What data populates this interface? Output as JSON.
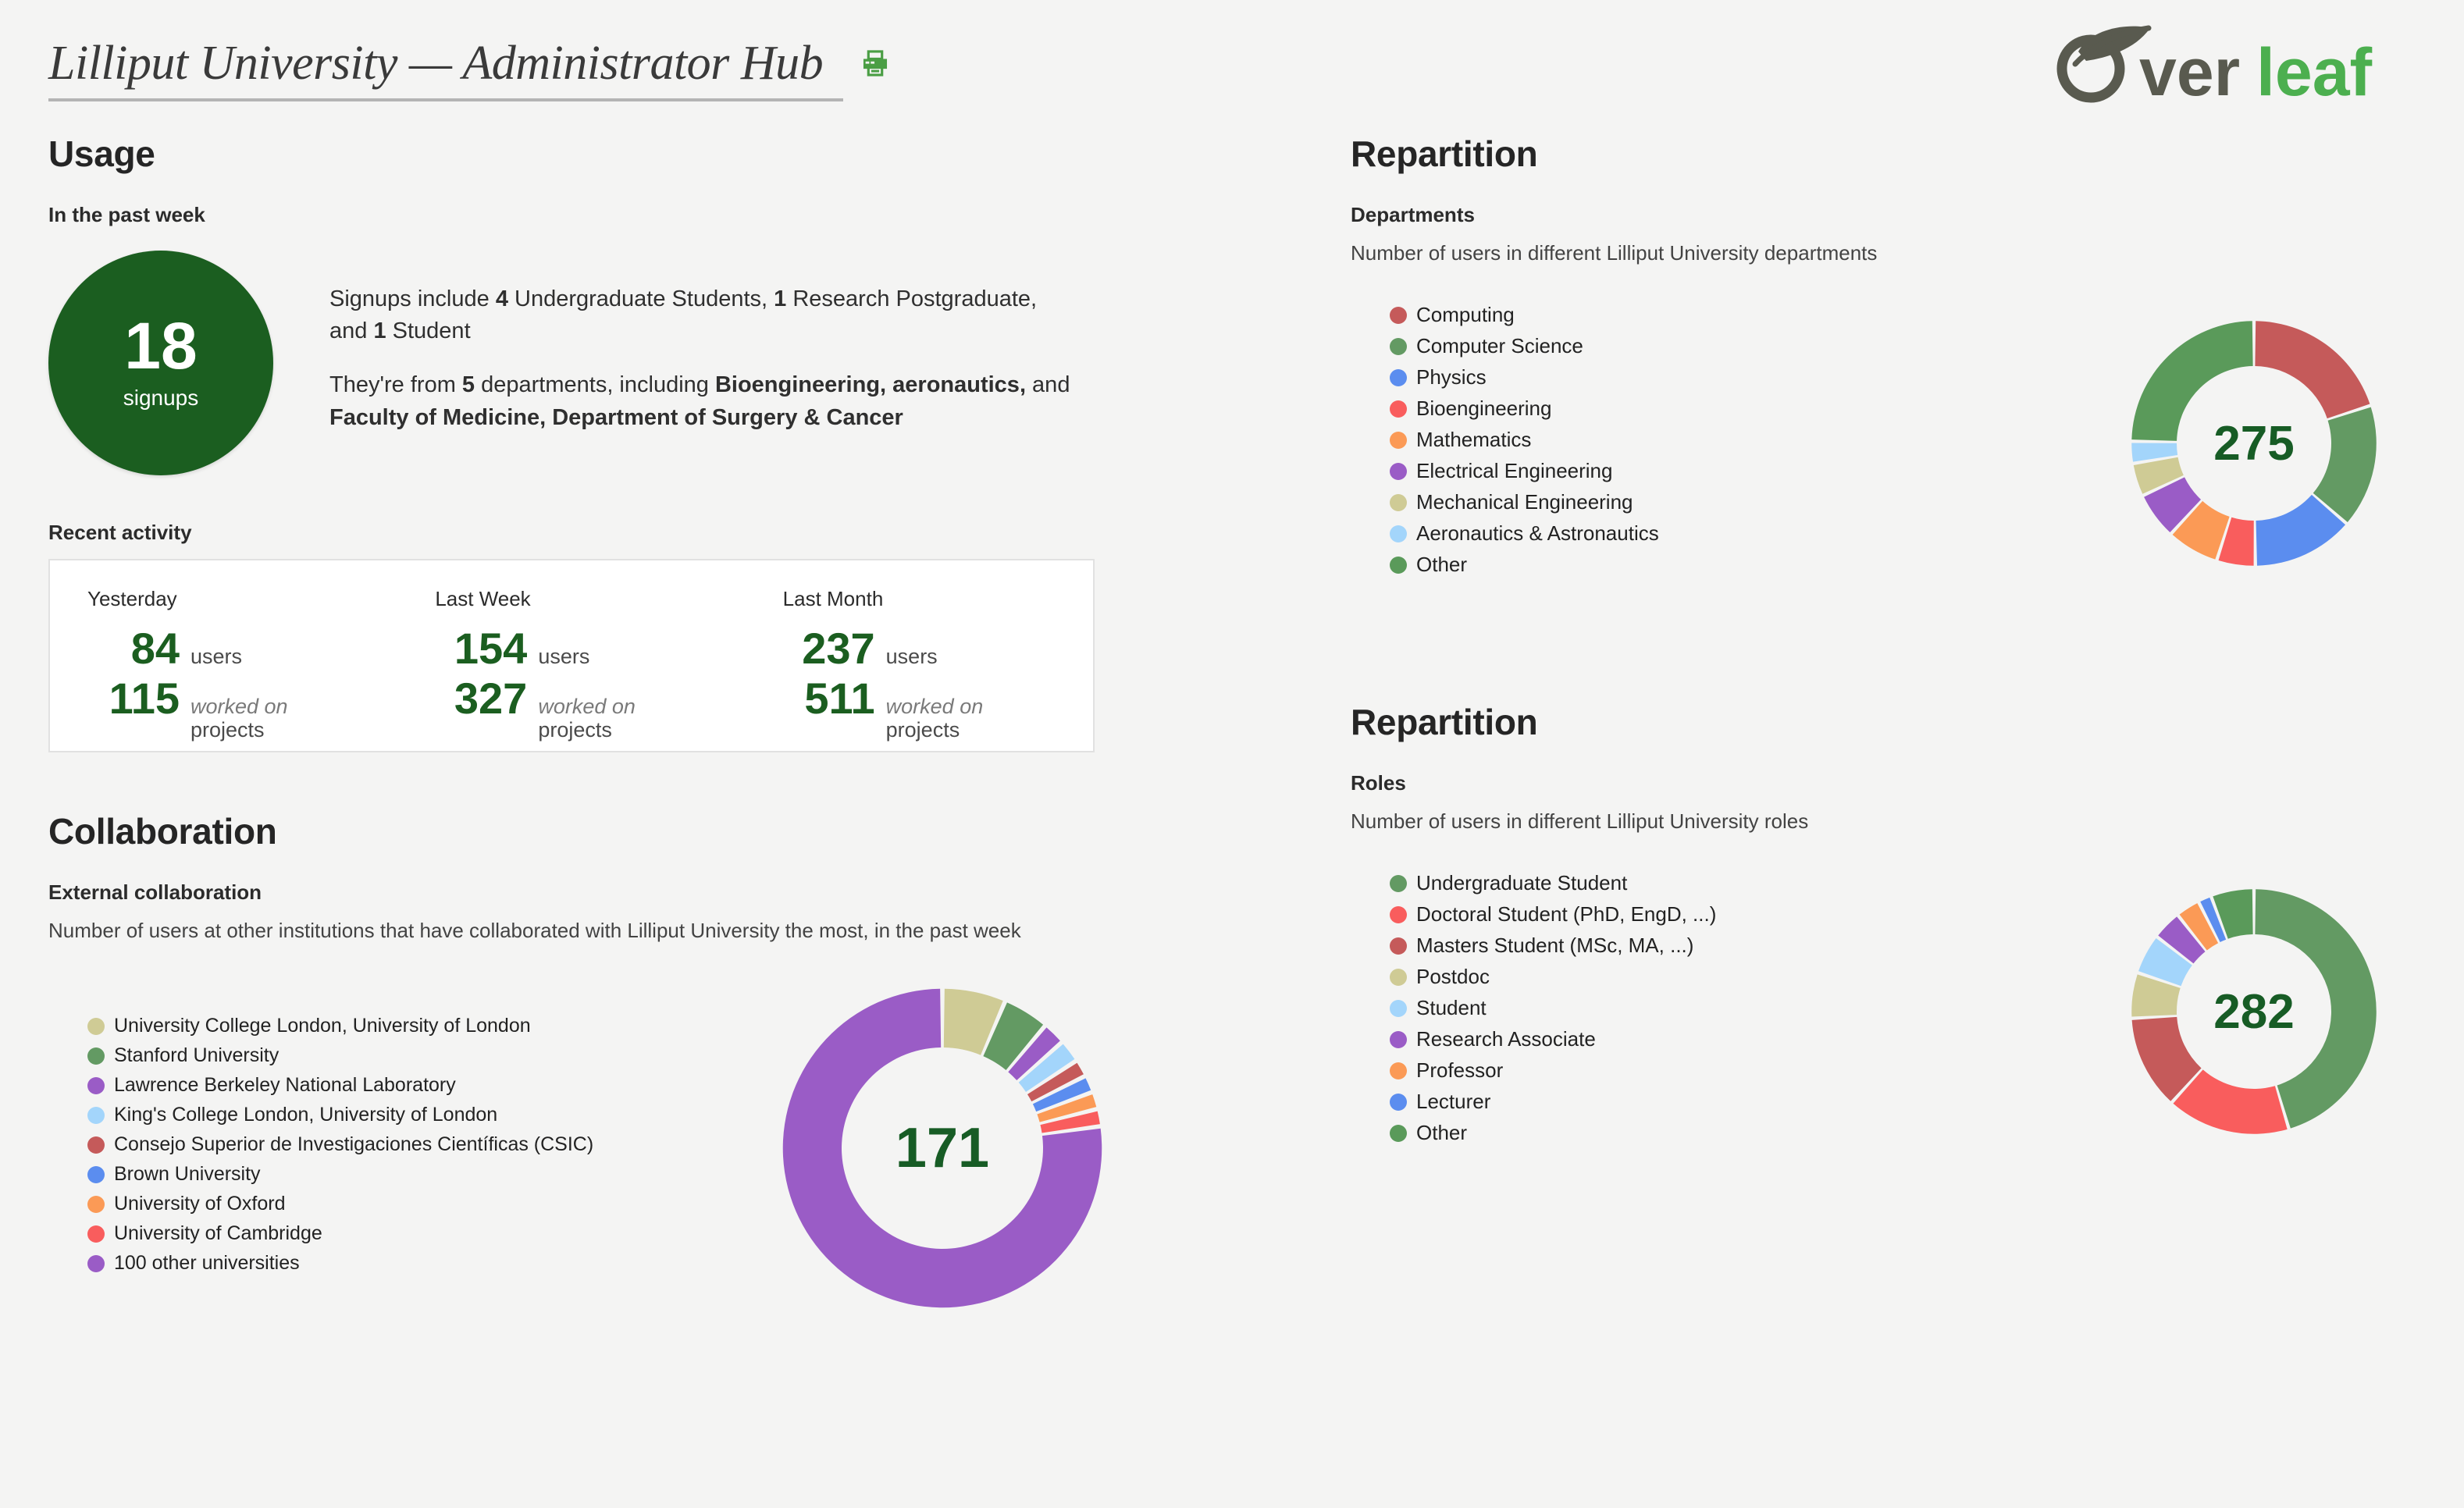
{
  "header": {
    "title": "Lilliput University — Administrator Hub",
    "print_icon": "printer-icon",
    "logo_text_dark": "ver",
    "logo_text_green": "leaf",
    "logo_alt": "Overleaf"
  },
  "usage": {
    "section_title": "Usage",
    "subtitle": "In the past week",
    "signups_count": "18",
    "signups_label": "signups",
    "paragraph_1": {
      "part_1": "Signups include ",
      "bold_1": "4",
      "part_2": " Undergraduate Students, ",
      "bold_2": "1",
      "part_3": " Research Postgraduate, and ",
      "bold_3": "1",
      "part_4": " Student"
    },
    "paragraph_2": {
      "part_1": "They're from ",
      "bold_1": "5",
      "part_2": " departments, including ",
      "bold_2": "Bioengineering, aeronautics,",
      "part_3": " and ",
      "bold_3": "Faculty of Medicine, Department of Surgery & Cancer"
    },
    "recent_activity_title": "Recent activity",
    "recent_activity": [
      {
        "when": "Yesterday",
        "users": "84",
        "users_unit": "users",
        "projects": "115",
        "projects_unit_line1": "worked on",
        "projects_unit_line2": "projects"
      },
      {
        "when": "Last Week",
        "users": "154",
        "users_unit": "users",
        "projects": "327",
        "projects_unit_line1": "worked on",
        "projects_unit_line2": "projects"
      },
      {
        "when": "Last Month",
        "users": "237",
        "users_unit": "users",
        "projects": "511",
        "projects_unit_line1": "worked on",
        "projects_unit_line2": "projects"
      }
    ]
  },
  "departments": {
    "section_title": "Repartition",
    "sub_head": "Departments",
    "sub_desc": "Number of users in different Lilliput University departments",
    "total": "275"
  },
  "collaboration": {
    "section_title": "Collaboration",
    "sub_head": "External collaboration",
    "sub_desc": "Number of users at other institutions that have collaborated with Lilliput University the most, in the past week",
    "total": "171"
  },
  "roles": {
    "section_title": "Repartition",
    "sub_head": "Roles",
    "sub_desc": "Number of users in different Lilliput University roles",
    "total": "282"
  },
  "chart_data": [
    {
      "id": "departments",
      "type": "pie",
      "title": "Departments",
      "subtitle": "Number of users in different Lilliput University departments",
      "center_label": "275",
      "total": 275,
      "legend_position": "left",
      "categories": [
        "Computing",
        "Computer Science",
        "Physics",
        "Bioengineering",
        "Mathematics",
        "Electrical Engineering",
        "Mechanical Engineering",
        "Aeronautics & Astronautics",
        "Other"
      ],
      "values": [
        55,
        45,
        37,
        14,
        19,
        17,
        12,
        8,
        68
      ],
      "colors": [
        "#c55a5a",
        "#639a63",
        "#5b8def",
        "#f95d5d",
        "#fb9a56",
        "#9a5cc6",
        "#cfcb95",
        "#a3d5fb",
        "#5a9a5a"
      ]
    },
    {
      "id": "external_collaboration",
      "type": "pie",
      "title": "External collaboration",
      "subtitle": "Number of users at other institutions that have collaborated with Lilliput University the most, in the past week",
      "center_label": "171",
      "total": 171,
      "legend_position": "left",
      "categories": [
        "University College London, University of London",
        "Stanford University",
        "Lawrence Berkeley National Laboratory",
        "King's College London, University of London",
        "Consejo Superior de Investigaciones Científicas (CSIC)",
        "Brown University",
        "University of Oxford",
        "University of Cambridge",
        "100 other universities"
      ],
      "values": [
        11,
        8,
        4,
        4,
        3,
        3,
        3,
        3,
        132
      ],
      "colors": [
        "#cfcb95",
        "#639a63",
        "#9a5cc6",
        "#a3d5fb",
        "#c55a5a",
        "#5b8def",
        "#fb9a56",
        "#f95d5d",
        "#9a5cc6"
      ]
    },
    {
      "id": "roles",
      "type": "pie",
      "title": "Roles",
      "subtitle": "Number of users in different Lilliput University roles",
      "center_label": "282",
      "total": 282,
      "legend_position": "left",
      "categories": [
        "Undergraduate Student",
        "Doctoral Student (PhD, EngD, ...)",
        "Masters Student (MSc, MA, ...)",
        "Postdoc",
        "Student",
        "Research Associate",
        "Professor",
        "Lecturer",
        "Other"
      ],
      "values": [
        128,
        46,
        35,
        17,
        15,
        11,
        9,
        5,
        16
      ],
      "colors": [
        "#639a63",
        "#f95d5d",
        "#c55a5a",
        "#cfcb95",
        "#a3d5fb",
        "#9a5cc6",
        "#fb9a56",
        "#5b8def",
        "#5a9a5a"
      ]
    }
  ]
}
